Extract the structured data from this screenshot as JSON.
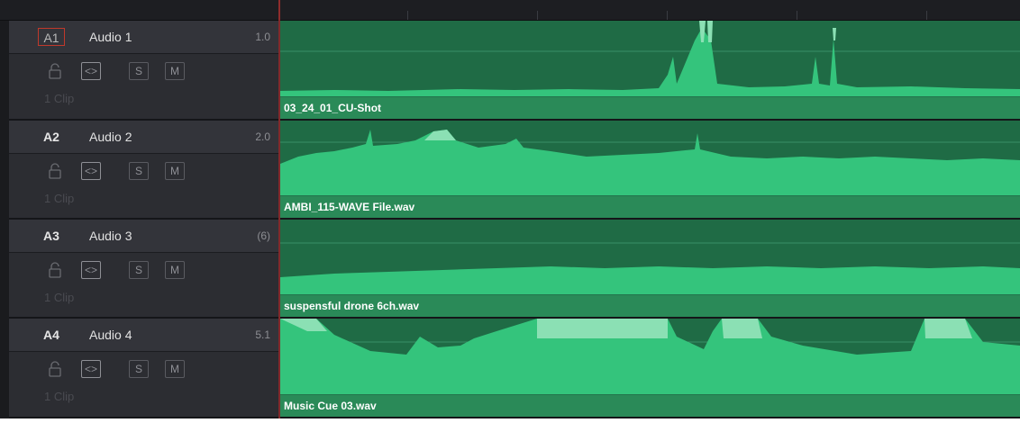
{
  "colors": {
    "header_bg": "#2c2d32",
    "clip_bg": "#1f6b45",
    "waveform_light": "#34c47c",
    "waveform_peak": "#8be0b4",
    "clip_name_bar": "#2a8a58",
    "playhead": "#c33a3a"
  },
  "tracks": [
    {
      "badge": "A1",
      "name": "Audio 1",
      "value": "1.0",
      "lock_icon": "lock-icon",
      "auto_label": "<>",
      "solo_label": "S",
      "mute_label": "M",
      "clip_count": "1 Clip",
      "clip_name": "03_24_01_CU-Shot"
    },
    {
      "badge": "A2",
      "name": "Audio 2",
      "value": "2.0",
      "lock_icon": "lock-icon",
      "auto_label": "<>",
      "solo_label": "S",
      "mute_label": "M",
      "clip_count": "1 Clip",
      "clip_name": "AMBI_115-WAVE File.wav"
    },
    {
      "badge": "A3",
      "name": "Audio 3",
      "value": "(6)",
      "lock_icon": "lock-icon",
      "auto_label": "<>",
      "solo_label": "S",
      "mute_label": "M",
      "clip_count": "1 Clip",
      "clip_name": "suspensful drone 6ch.wav"
    },
    {
      "badge": "A4",
      "name": "Audio 4",
      "value": "5.1",
      "lock_icon": "lock-icon",
      "auto_label": "<>",
      "solo_label": "S",
      "mute_label": "M",
      "clip_count": "1 Clip",
      "clip_name": "Music Cue 03.wav"
    }
  ]
}
